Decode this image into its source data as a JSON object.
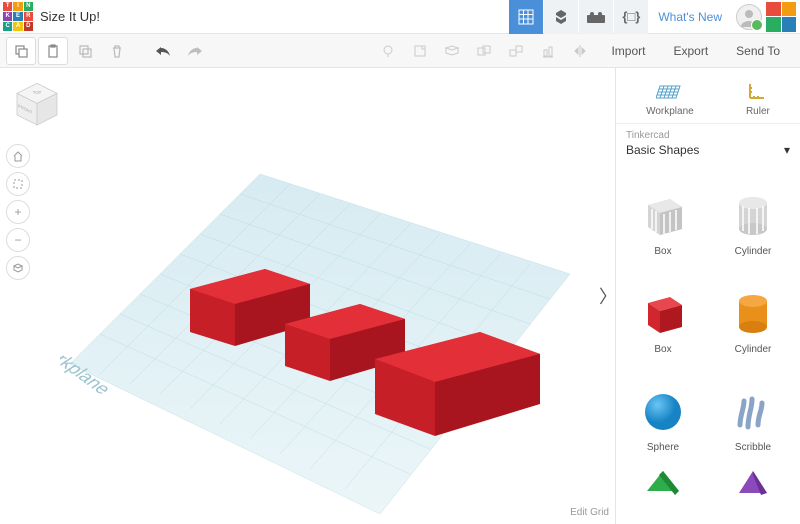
{
  "header": {
    "title": "Size It Up!",
    "whats_new": "What's New"
  },
  "toolbar": {
    "import": "Import",
    "export": "Export",
    "send_to": "Send To"
  },
  "canvas": {
    "workplane_label": "Workplane",
    "edit_grid": "Edit Grid",
    "cube_front": "FRONT",
    "cube_top": "TOP"
  },
  "sidebar": {
    "workplane": "Workplane",
    "ruler": "Ruler",
    "category_header": "Tinkercad",
    "category": "Basic Shapes",
    "shapes": [
      {
        "label": "Box",
        "kind": "box-striped"
      },
      {
        "label": "Cylinder",
        "kind": "cyl-striped"
      },
      {
        "label": "Box",
        "kind": "box-red"
      },
      {
        "label": "Cylinder",
        "kind": "cyl-orange"
      },
      {
        "label": "Sphere",
        "kind": "sphere-blue"
      },
      {
        "label": "Scribble",
        "kind": "scribble"
      }
    ]
  }
}
